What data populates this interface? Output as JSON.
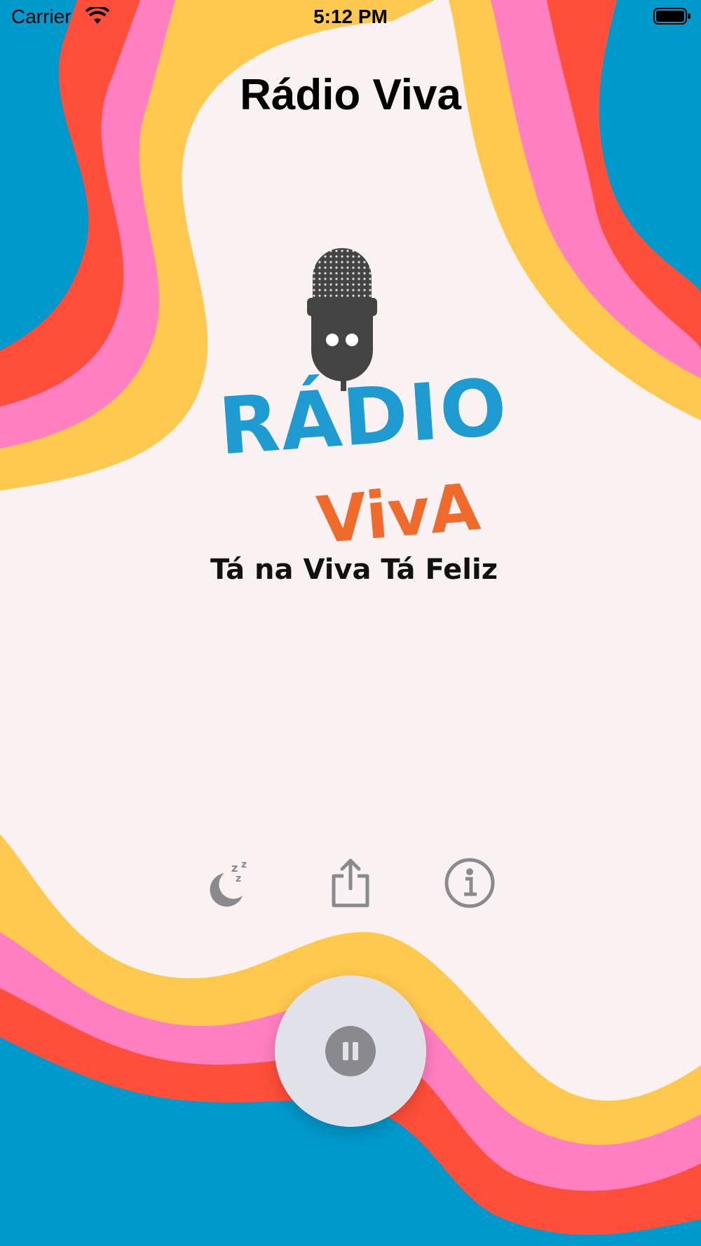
{
  "status_bar": {
    "carrier": "Carrier",
    "time": "5:12 PM"
  },
  "header": {
    "title": "Rádio Viva"
  },
  "logo": {
    "word1": "RÁDIO",
    "word2": "VivA",
    "slogan": "Tá na Viva Tá Feliz"
  },
  "actions": [
    {
      "icon": "sleep-timer-icon"
    },
    {
      "icon": "share-icon"
    },
    {
      "icon": "info-icon"
    }
  ],
  "player": {
    "state": "playing",
    "button_icon": "pause-icon"
  },
  "colors": {
    "blue": "#0099cc",
    "red": "#ff4f3a",
    "pink": "#ff7fc0",
    "yellow": "#ffc94f",
    "cream": "#faf2f2",
    "icon_gray": "#8a8a8e"
  }
}
